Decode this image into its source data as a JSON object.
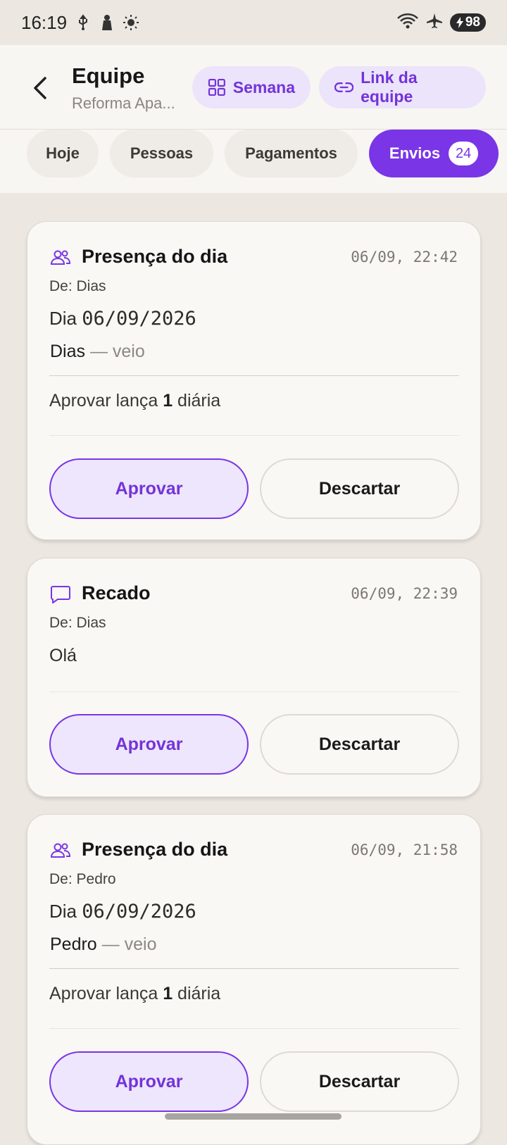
{
  "status_bar": {
    "time": "16:19",
    "battery": "98"
  },
  "header": {
    "title": "Equipe",
    "subtitle": "Reforma Apa...",
    "week_button": "Semana",
    "link_button": "Link da equipe"
  },
  "tabs": [
    {
      "label": "Hoje"
    },
    {
      "label": "Pessoas"
    },
    {
      "label": "Pagamentos"
    },
    {
      "label": "Envios",
      "count": "24",
      "active": true
    }
  ],
  "cards": [
    {
      "type": "Presença do dia",
      "time": "06/09, 22:42",
      "from": "De: Dias",
      "day_prefix": "Dia ",
      "day_value": "06/09/2026",
      "person": "Dias",
      "status": " — veio",
      "note_prefix": "Aprovar lança ",
      "note_count": "1",
      "note_suffix": " diária",
      "approve": "Aprovar",
      "discard": "Descartar"
    },
    {
      "type": "Recado",
      "time": "06/09, 22:39",
      "from": "De: Dias",
      "message": "Olá",
      "approve": "Aprovar",
      "discard": "Descartar"
    },
    {
      "type": "Presença do dia",
      "time": "06/09, 21:58",
      "from": "De: Pedro",
      "day_prefix": "Dia ",
      "day_value": "06/09/2026",
      "person": "Pedro",
      "status": " — veio",
      "note_prefix": "Aprovar lança ",
      "note_count": "1",
      "note_suffix": " diária",
      "approve": "Aprovar",
      "discard": "Descartar"
    }
  ],
  "colors": {
    "accent": "#7a35e6",
    "accent_soft": "#ede6fc",
    "background": "#ece7e1",
    "card": "#f9f8f5"
  },
  "icons": [
    "usb-icon",
    "notification-icon",
    "brightness-icon",
    "wifi-icon",
    "airplane-icon",
    "battery-icon",
    "back-arrow-icon",
    "grid-icon",
    "link-icon",
    "people-icon",
    "chat-bubble-icon"
  ]
}
